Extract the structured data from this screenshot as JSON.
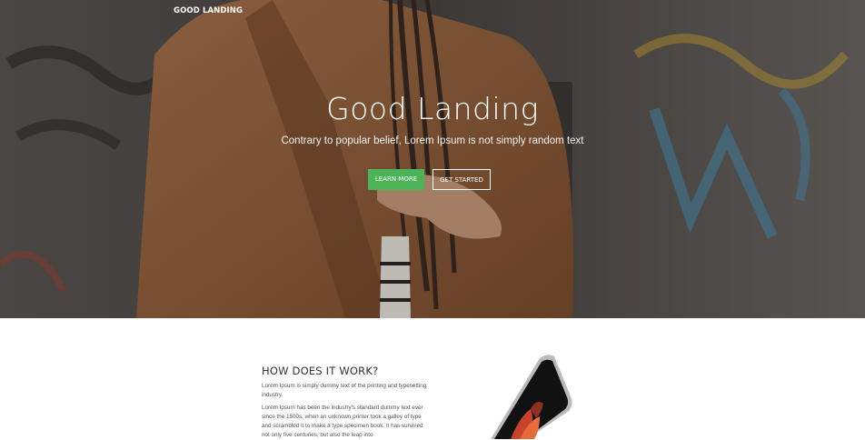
{
  "brand": "GOOD LANDING",
  "hero": {
    "title": "Good Landing",
    "subtitle": "Contrary to popular belief, Lorem Ipsum is not simply random text",
    "learn_more": "LEARN MORE",
    "get_started": "GET STARTED"
  },
  "how": {
    "title": "HOW DOES IT WORK?",
    "para1": "Lorem Ipsum is simply dummy text of the printing and typesetting industry.",
    "para2": "Lorem Ipsum has been the industry's standard dummy text ever since the 1500s, when an unknown printer took a galley of type and scrambled it to make a type specimen book. It has survived not only five centuries, but also the leap into"
  },
  "colors": {
    "accent_green": "#4cb357",
    "text_dark": "#333333"
  }
}
